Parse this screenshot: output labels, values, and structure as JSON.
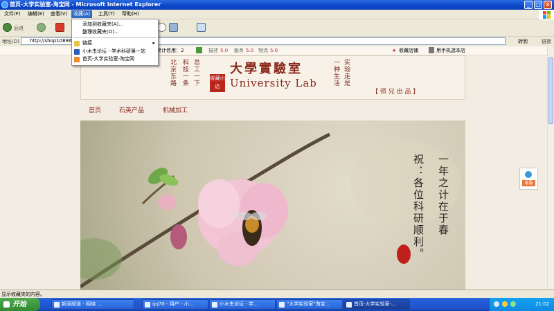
{
  "window": {
    "title": "首页-大学实验室-淘宝网 - Microsoft Internet Explorer"
  },
  "menubar": {
    "items": [
      "文件(F)",
      "编辑(E)",
      "查看(V)",
      "收藏(A)",
      "工具(T)",
      "帮助(H)"
    ]
  },
  "toolbar": {
    "back_label": "后退"
  },
  "address": {
    "label": "地址(D)",
    "url": "http://shop108869...",
    "go_label": "转到",
    "links_label": "链接"
  },
  "favorites_menu": {
    "add": "添加到收藏夹(A)...",
    "organize": "整理收藏夹(O)...",
    "links": "链接",
    "entries": [
      "小木虫论坛 - 学术科研第一站",
      "首页-大学实验室-淘宝网"
    ]
  },
  "infobar": {
    "credit": "累计信用：2",
    "describe": "描述",
    "describe_score": "5.0",
    "service": "服务",
    "service_score": "5.0",
    "logistics": "物流",
    "logistics_score": "5.0",
    "fav_shop": "收藏店铺",
    "mobile": "用手机逛本店"
  },
  "banner": {
    "left_v1": "北京东路",
    "left_v2": "科技一条",
    "left_v3": "总工一下",
    "seal": "收藏小店",
    "title_cn": "大學實驗室",
    "title_en": "University Lab",
    "right_v1": "一种生活",
    "right_v2": "实验走是",
    "signature": "【 师 兄 出 品 】"
  },
  "nav": {
    "items": [
      "首页",
      "石英产品",
      "机械加工"
    ]
  },
  "hero": {
    "poem_col1": "一年之计在于春",
    "poem_col2": "祝：各位科研顺利。"
  },
  "side_widget": {
    "label": "客服"
  },
  "statusbar": {
    "text": "显示收藏夹的内容。"
  },
  "taskbar": {
    "start": "开始",
    "tasks": [
      "新闻频道 - 网络 ...",
      "qq70 - 用户 - 小...",
      "小木虫论坛 - 学...",
      "\"大学实验室\"淘宝...",
      "首页-大学实验室-..."
    ],
    "clock": "21:02"
  }
}
